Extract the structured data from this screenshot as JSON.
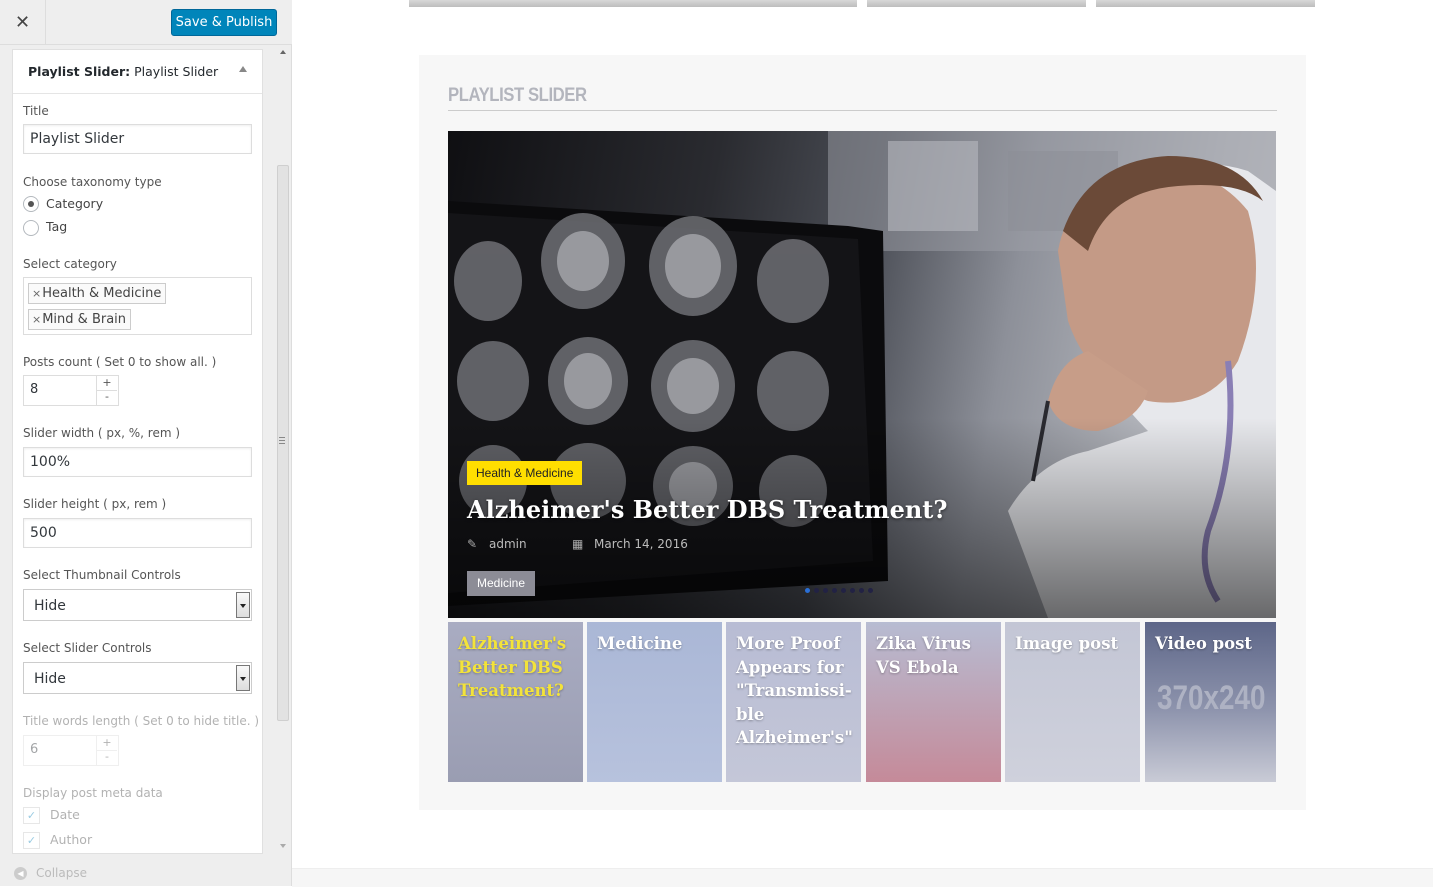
{
  "topbar": {
    "close_icon": "close-icon",
    "publish_label": "Save & Publish",
    "accent": "#0085ba"
  },
  "panel": {
    "title_bold": "Playlist Slider:",
    "title_rest": " Playlist Slider",
    "fields": {
      "title_label": "Title",
      "title_value": "Playlist Slider",
      "taxonomy_label": "Choose taxonomy type",
      "taxonomy_options": [
        "Category",
        "Tag"
      ],
      "taxonomy_selected": "Category",
      "category_label": "Select category",
      "categories": [
        "Health & Medicine",
        "Mind & Brain"
      ],
      "posts_count_label": "Posts count ( Set 0 to show all. )",
      "posts_count_value": "8",
      "slider_width_label": "Slider width ( px, %, rem )",
      "slider_width_value": "100%",
      "slider_height_label": "Slider height ( px, rem )",
      "slider_height_value": "500",
      "thumb_controls_label": "Select Thumbnail Controls",
      "thumb_controls_value": "Hide",
      "slider_controls_label": "Select Slider Controls",
      "slider_controls_value": "Hide",
      "title_words_label": "Title words length ( Set 0 to hide title. )",
      "title_words_value": "6",
      "meta_label": "Display post meta data",
      "meta_options": [
        "Date",
        "Author"
      ]
    },
    "spinner_up": "+",
    "spinner_down": "-",
    "collapse_label": "Collapse"
  },
  "preview": {
    "widget_title": "PLAYLIST SLIDER",
    "hero": {
      "category": "Health & Medicine",
      "title": "Alzheimer's Better DBS Treatment?",
      "author": "admin",
      "date": "March 14, 2016",
      "tag": "Medicine",
      "category_color": "#ffde00"
    },
    "thumbnails": [
      {
        "title": "Alzheimer's Better DBS Treatment?",
        "active": true
      },
      {
        "title": "Medicine"
      },
      {
        "title": "More Proof Appears for \"Transmissi-ble Alzheimer's\""
      },
      {
        "title": "Zika Virus VS Ebola"
      },
      {
        "title": "Image post"
      },
      {
        "title": "Video post",
        "placeholder": "370x240"
      }
    ]
  }
}
